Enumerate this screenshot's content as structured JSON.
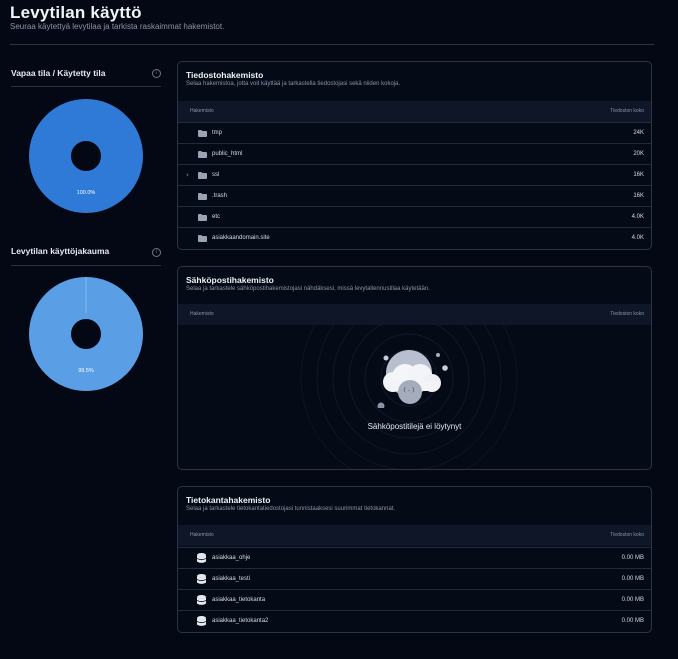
{
  "header": {
    "title": "Levytilan käyttö",
    "subtitle": "Seuraa käytettyä levytilaa ja tarkista raskaimmat hakemistot."
  },
  "sidebar": {
    "free_used": {
      "title": "Vapaa tila / Käytetty tila",
      "label": "100.0%",
      "value": 100.0,
      "color": "#2f7ad6"
    },
    "distribution": {
      "title": "Levytilan käyttöjakauma",
      "label": "99.5%",
      "value": 99.5,
      "color": "#5a9fe6"
    }
  },
  "file_dirs": {
    "title": "Tiedostohakemisto",
    "subtitle": "Selaa hakemistoa, jotta voit käyttää ja tarkastella tiedostojasi sekä niiden kokoja.",
    "col_name": "Hakemisto",
    "col_size": "Tiedoston koko",
    "rows": [
      {
        "name": "tmp",
        "size": "24K",
        "expandable": false
      },
      {
        "name": "public_html",
        "size": "20K",
        "expandable": false
      },
      {
        "name": "ssl",
        "size": "16K",
        "expandable": true
      },
      {
        "name": ".trash",
        "size": "16K",
        "expandable": false
      },
      {
        "name": "etc",
        "size": "4.0K",
        "expandable": false
      },
      {
        "name": "asiakkaandomain.site",
        "size": "4.0K",
        "expandable": false
      }
    ]
  },
  "email_dirs": {
    "title": "Sähköpostihakemisto",
    "subtitle": "Selaa ja tarkastele sähköpostihakemistojasi nähdäksesi, missä levytallennustilaa käytetään.",
    "col_name": "Hakemisto",
    "col_size": "Tiedoston koko",
    "empty_text": "Sähköpostitilejä ei löytynyt",
    "empty_face": "( - )"
  },
  "db_dirs": {
    "title": "Tietokantahakemisto",
    "subtitle": "Selaa ja tarkastele tietokantatiedostojasi tunnistaaksesi suurimmat tietokannat.",
    "col_name": "Hakemisto",
    "col_size": "Tiedoston koko",
    "rows": [
      {
        "name": "asiakkaa_ohje",
        "size": "0.00 MB"
      },
      {
        "name": "asiakkaa_testi",
        "size": "0.00 MB"
      },
      {
        "name": "asiakkaa_tietokanta",
        "size": "0.00 MB"
      },
      {
        "name": "asiakkaa_tietokanta2",
        "size": "0.00 MB"
      }
    ]
  },
  "icons": {
    "info": "info-icon",
    "folder": "folder-icon",
    "database": "database-icon",
    "chevron": "chevron-right-icon",
    "empty": "cloud-empty-icon"
  }
}
